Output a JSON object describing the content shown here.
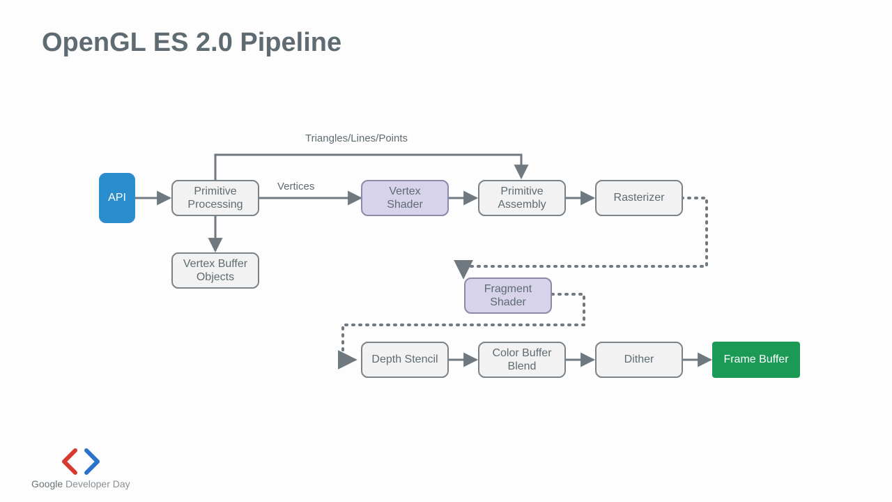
{
  "title": "OpenGL ES 2.0 Pipeline",
  "nodes": {
    "api": "API",
    "primitive_processing": "Primitive\nProcessing",
    "vertex_shader": "Vertex\nShader",
    "primitive_assembly": "Primitive\nAssembly",
    "rasterizer": "Rasterizer",
    "vertex_buffer_objects": "Vertex Buffer\nObjects",
    "fragment_shader": "Fragment\nShader",
    "depth_stencil": "Depth Stencil",
    "color_buffer_blend": "Color Buffer\nBlend",
    "dither": "Dither",
    "frame_buffer": "Frame Buffer"
  },
  "edge_labels": {
    "triangles_lines_points": "Triangles/Lines/Points",
    "vertices": "Vertices"
  },
  "logo": {
    "line1": "Google",
    "line2": "Developer Day"
  },
  "colors": {
    "stroke": "#707880",
    "dotted": "#707880",
    "blue": "#2a8ece",
    "purple": "#d6d3eb",
    "green": "#1a9a55"
  }
}
